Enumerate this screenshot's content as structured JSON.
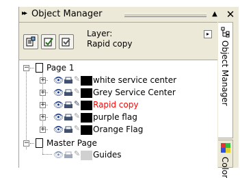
{
  "title": "Object Manager",
  "toolbar": {
    "layer_label": "Layer:",
    "layer_name": "Rapid copy"
  },
  "tree": {
    "page1": "Page 1",
    "layers": [
      {
        "name": "white service center",
        "color": "#000000"
      },
      {
        "name": "Grey Service Center",
        "color": "#000000"
      },
      {
        "name": "Rapid copy",
        "color": "#ff0000"
      },
      {
        "name": "purple flag",
        "color": "#000000"
      },
      {
        "name": "Orange Flag",
        "color": "#000000"
      }
    ],
    "master": "Master Page",
    "guides": "Guides"
  },
  "tabs": {
    "object_manager": "Object Manager",
    "color": "Color"
  },
  "colors": {
    "active_layer": "#ff0000",
    "panel_bg": "#ece9d8"
  }
}
